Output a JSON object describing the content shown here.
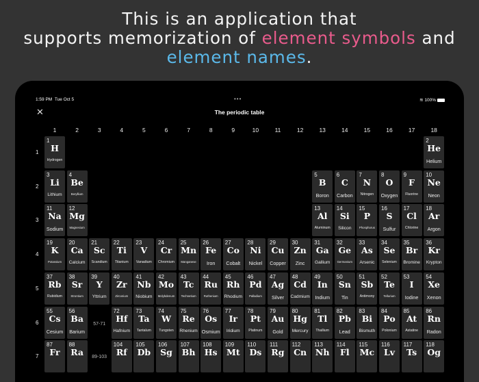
{
  "headline": {
    "line1": "This is an application that",
    "line2_a": "supports memorization of ",
    "line2_pink": "element symbols",
    "line2_b": " and",
    "line3_blue": "element names",
    "line3_end": "."
  },
  "colors": {
    "pink": "#e95b8c",
    "blue": "#5bb9ea"
  },
  "status": {
    "time": "1:59 PM",
    "date": "Tue Oct 5",
    "dots": "•••",
    "battery": "100%",
    "wifi_icon": "wifi-icon"
  },
  "nav": {
    "title": "The periodic table",
    "close": "✕"
  },
  "groups": [
    "1",
    "2",
    "3",
    "4",
    "5",
    "6",
    "7",
    "8",
    "9",
    "10",
    "11",
    "12",
    "13",
    "14",
    "15",
    "16",
    "17",
    "18"
  ],
  "periods": [
    "1",
    "2",
    "3",
    "4",
    "5",
    "6",
    "7"
  ],
  "placeholders": [
    {
      "label": "57-71",
      "period": 6,
      "group": 3
    },
    {
      "label": "89-103",
      "period": 7,
      "group": 3
    }
  ],
  "elements": [
    [
      1,
      "H",
      "Hydrogen",
      1,
      1
    ],
    [
      2,
      "He",
      "Helium",
      1,
      18
    ],
    [
      3,
      "Li",
      "Lithium",
      2,
      1
    ],
    [
      4,
      "Be",
      "Beryllium",
      2,
      2
    ],
    [
      5,
      "B",
      "Boron",
      2,
      13
    ],
    [
      6,
      "C",
      "Carbon",
      2,
      14
    ],
    [
      7,
      "N",
      "Nitrogen",
      2,
      15
    ],
    [
      8,
      "O",
      "Oxygen",
      2,
      16
    ],
    [
      9,
      "F",
      "Fluorine",
      2,
      17
    ],
    [
      10,
      "Ne",
      "Neon",
      2,
      18
    ],
    [
      11,
      "Na",
      "Sodium",
      3,
      1
    ],
    [
      12,
      "Mg",
      "Magnesium",
      3,
      2
    ],
    [
      13,
      "Al",
      "Aluminum",
      3,
      13
    ],
    [
      14,
      "Si",
      "Silicon",
      3,
      14
    ],
    [
      15,
      "P",
      "Phosphorus",
      3,
      15
    ],
    [
      16,
      "S",
      "Sulfur",
      3,
      16
    ],
    [
      17,
      "Cl",
      "Chlorine",
      3,
      17
    ],
    [
      18,
      "Ar",
      "Argon",
      3,
      18
    ],
    [
      19,
      "K",
      "Potassium",
      4,
      1
    ],
    [
      20,
      "Ca",
      "Calcium",
      4,
      2
    ],
    [
      21,
      "Sc",
      "Scandium",
      4,
      3
    ],
    [
      22,
      "Ti",
      "Titanium",
      4,
      4
    ],
    [
      23,
      "V",
      "Vanadium",
      4,
      5
    ],
    [
      24,
      "Cr",
      "Chromium",
      4,
      6
    ],
    [
      25,
      "Mn",
      "Manganese",
      4,
      7
    ],
    [
      26,
      "Fe",
      "Iron",
      4,
      8
    ],
    [
      27,
      "Co",
      "Cobalt",
      4,
      9
    ],
    [
      28,
      "Ni",
      "Nickel",
      4,
      10
    ],
    [
      29,
      "Cu",
      "Copper",
      4,
      11
    ],
    [
      30,
      "Zn",
      "Zinc",
      4,
      12
    ],
    [
      31,
      "Ga",
      "Gallium",
      4,
      13
    ],
    [
      32,
      "Ge",
      "Germanium",
      4,
      14
    ],
    [
      33,
      "As",
      "Arsenic",
      4,
      15
    ],
    [
      34,
      "Se",
      "Selenium",
      4,
      16
    ],
    [
      35,
      "Br",
      "Bromine",
      4,
      17
    ],
    [
      36,
      "Kr",
      "Krypton",
      4,
      18
    ],
    [
      37,
      "Rb",
      "Rubidium",
      5,
      1
    ],
    [
      38,
      "Sr",
      "Strontium",
      5,
      2
    ],
    [
      39,
      "Y",
      "Yttrium",
      5,
      3
    ],
    [
      40,
      "Zr",
      "Zirconium",
      5,
      4
    ],
    [
      41,
      "Nb",
      "Niobium",
      5,
      5
    ],
    [
      42,
      "Mo",
      "Molybdenum",
      5,
      6
    ],
    [
      43,
      "Tc",
      "Technetium",
      5,
      7
    ],
    [
      44,
      "Ru",
      "Ruthenium",
      5,
      8
    ],
    [
      45,
      "Rh",
      "Rhodium",
      5,
      9
    ],
    [
      46,
      "Pd",
      "Palladium",
      5,
      10
    ],
    [
      47,
      "Ag",
      "Silver",
      5,
      11
    ],
    [
      48,
      "Cd",
      "Cadmium",
      5,
      12
    ],
    [
      49,
      "In",
      "Indium",
      5,
      13
    ],
    [
      50,
      "Sn",
      "Tin",
      5,
      14
    ],
    [
      51,
      "Sb",
      "Antimony",
      5,
      15
    ],
    [
      52,
      "Te",
      "Tellurium",
      5,
      16
    ],
    [
      53,
      "I",
      "Iodine",
      5,
      17
    ],
    [
      54,
      "Xe",
      "Xenon",
      5,
      18
    ],
    [
      55,
      "Cs",
      "Cesium",
      6,
      1
    ],
    [
      56,
      "Ba",
      "Barium",
      6,
      2
    ],
    [
      72,
      "Hf",
      "Hafnium",
      6,
      4
    ],
    [
      73,
      "Ta",
      "Tantalum",
      6,
      5
    ],
    [
      74,
      "W",
      "Tungsten",
      6,
      6
    ],
    [
      75,
      "Re",
      "Rhenium",
      6,
      7
    ],
    [
      76,
      "Os",
      "Osmium",
      6,
      8
    ],
    [
      77,
      "Ir",
      "Iridium",
      6,
      9
    ],
    [
      78,
      "Pt",
      "Platinum",
      6,
      10
    ],
    [
      79,
      "Au",
      "Gold",
      6,
      11
    ],
    [
      80,
      "Hg",
      "Mercury",
      6,
      12
    ],
    [
      81,
      "Tl",
      "Thallium",
      6,
      13
    ],
    [
      82,
      "Pb",
      "Lead",
      6,
      14
    ],
    [
      83,
      "Bi",
      "Bismuth",
      6,
      15
    ],
    [
      84,
      "Po",
      "Polonium",
      6,
      16
    ],
    [
      85,
      "At",
      "Astatine",
      6,
      17
    ],
    [
      86,
      "Rn",
      "Radon",
      6,
      18
    ],
    [
      87,
      "Fr",
      "",
      7,
      1
    ],
    [
      88,
      "Ra",
      "",
      7,
      2
    ],
    [
      104,
      "Rf",
      "",
      7,
      4
    ],
    [
      105,
      "Db",
      "",
      7,
      5
    ],
    [
      106,
      "Sg",
      "",
      7,
      6
    ],
    [
      107,
      "Bh",
      "",
      7,
      7
    ],
    [
      108,
      "Hs",
      "",
      7,
      8
    ],
    [
      109,
      "Mt",
      "",
      7,
      9
    ],
    [
      110,
      "Ds",
      "",
      7,
      10
    ],
    [
      111,
      "Rg",
      "",
      7,
      11
    ],
    [
      112,
      "Cn",
      "",
      7,
      12
    ],
    [
      113,
      "Nh",
      "",
      7,
      13
    ],
    [
      114,
      "Fl",
      "",
      7,
      14
    ],
    [
      115,
      "Mc",
      "",
      7,
      15
    ],
    [
      116,
      "Lv",
      "",
      7,
      16
    ],
    [
      117,
      "Ts",
      "",
      7,
      17
    ],
    [
      118,
      "Og",
      "",
      7,
      18
    ]
  ]
}
